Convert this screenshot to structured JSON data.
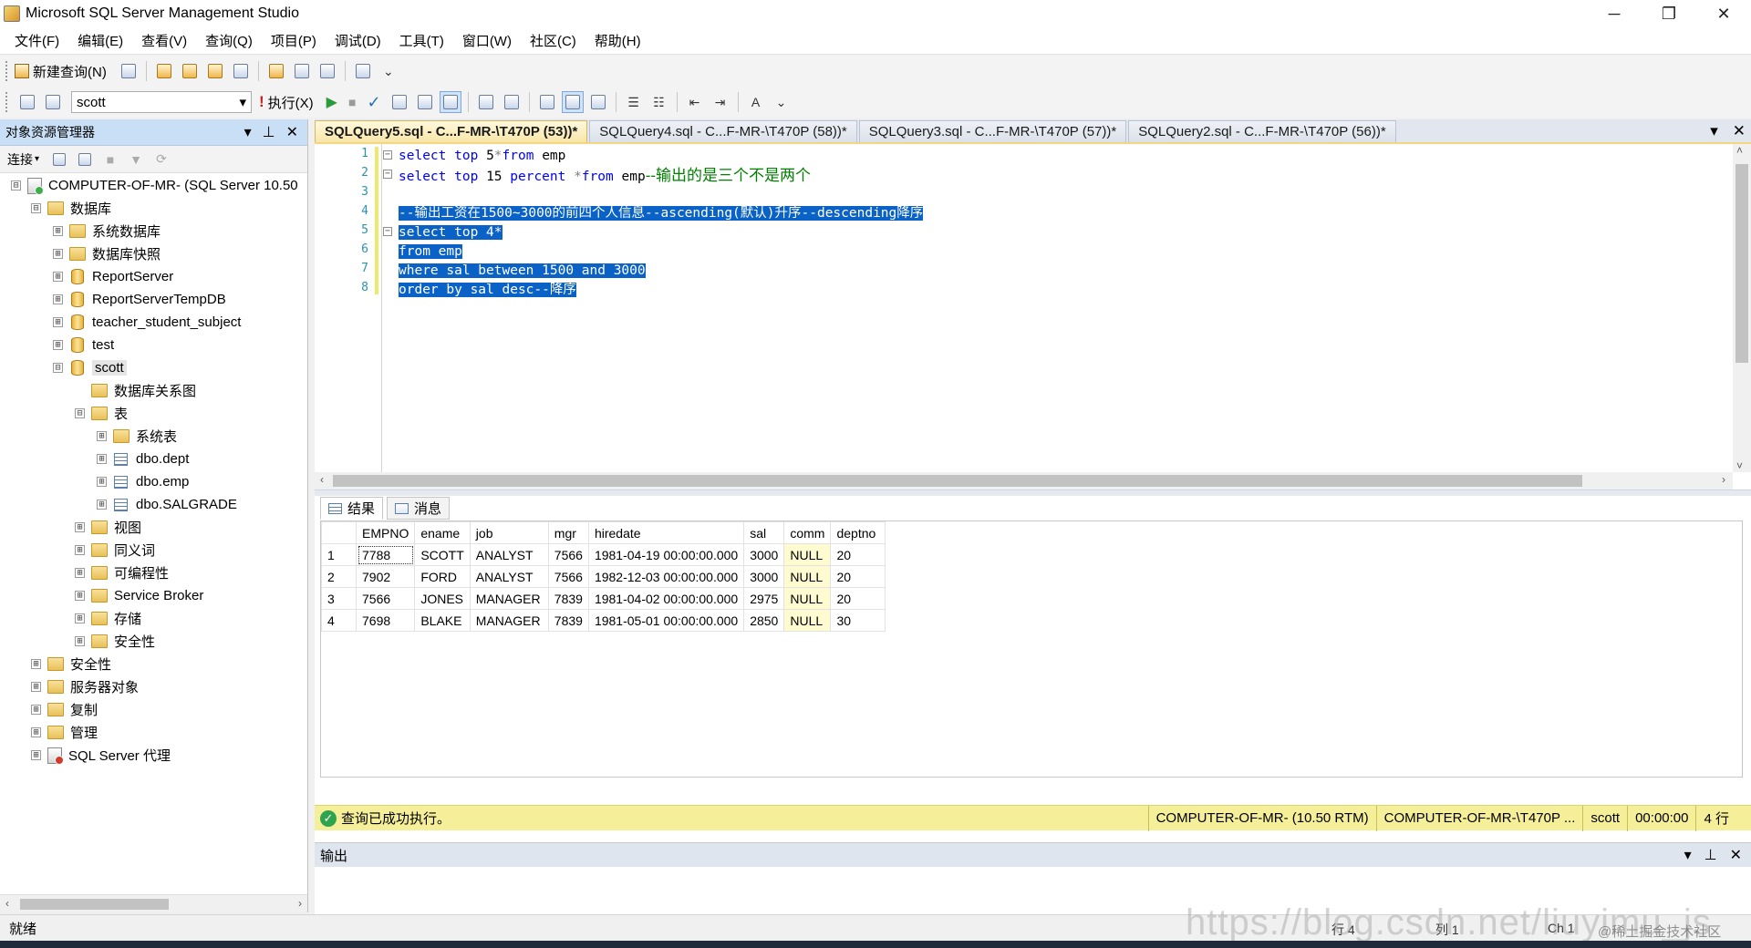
{
  "window": {
    "title": "Microsoft SQL Server Management Studio",
    "controls": [
      "─",
      "❐",
      "✕"
    ]
  },
  "menu": [
    "文件(F)",
    "编辑(E)",
    "查看(V)",
    "查询(Q)",
    "项目(P)",
    "调试(D)",
    "工具(T)",
    "窗口(W)",
    "社区(C)",
    "帮助(H)"
  ],
  "toolbar": {
    "new_query": "新建查询(N)",
    "database": "scott",
    "execute": "执行(X)"
  },
  "object_explorer": {
    "title": "对象资源管理器",
    "connect": "连接",
    "tree": [
      {
        "label": "COMPUTER-OF-MR- (SQL Server 10.50",
        "icon": "server-icon",
        "expander": "⊟"
      },
      {
        "label": "数据库",
        "icon": "folder-icon",
        "expander": "⊟"
      },
      {
        "label": "系统数据库",
        "icon": "folder-icon",
        "expander": "⊞"
      },
      {
        "label": "数据库快照",
        "icon": "folder-icon",
        "expander": "⊞"
      },
      {
        "label": "ReportServer",
        "icon": "database-icon",
        "expander": "⊞"
      },
      {
        "label": "ReportServerTempDB",
        "icon": "database-icon",
        "expander": "⊞"
      },
      {
        "label": "teacher_student_subject",
        "icon": "database-icon",
        "expander": "⊞"
      },
      {
        "label": "test",
        "icon": "database-icon",
        "expander": "⊞"
      },
      {
        "label": "scott",
        "icon": "database-icon",
        "expander": "⊟"
      },
      {
        "label": "数据库关系图",
        "icon": "folder-icon",
        "expander": ""
      },
      {
        "label": "表",
        "icon": "folder-icon",
        "expander": "⊟"
      },
      {
        "label": "系统表",
        "icon": "folder-icon",
        "expander": "⊞"
      },
      {
        "label": "dbo.dept",
        "icon": "table-icon",
        "expander": "⊞"
      },
      {
        "label": "dbo.emp",
        "icon": "table-icon",
        "expander": "⊞"
      },
      {
        "label": "dbo.SALGRADE",
        "icon": "table-icon",
        "expander": "⊞"
      },
      {
        "label": "视图",
        "icon": "folder-icon",
        "expander": "⊞"
      },
      {
        "label": "同义词",
        "icon": "folder-icon",
        "expander": "⊞"
      },
      {
        "label": "可编程性",
        "icon": "folder-icon",
        "expander": "⊞"
      },
      {
        "label": "Service Broker",
        "icon": "folder-icon",
        "expander": "⊞"
      },
      {
        "label": "存储",
        "icon": "folder-icon",
        "expander": "⊞"
      },
      {
        "label": "安全性",
        "icon": "folder-icon",
        "expander": "⊞"
      },
      {
        "label": "安全性",
        "icon": "folder-icon",
        "expander": "⊞"
      },
      {
        "label": "服务器对象",
        "icon": "folder-icon",
        "expander": "⊞"
      },
      {
        "label": "复制",
        "icon": "folder-icon",
        "expander": "⊞"
      },
      {
        "label": "管理",
        "icon": "folder-icon",
        "expander": "⊞"
      },
      {
        "label": "SQL Server 代理",
        "icon": "agent-icon",
        "expander": "⊞"
      }
    ]
  },
  "tabs": [
    {
      "label": "SQLQuery5.sql - C...F-MR-\\T470P (53))*",
      "active": true
    },
    {
      "label": "SQLQuery4.sql - C...F-MR-\\T470P (58))*",
      "active": false
    },
    {
      "label": "SQLQuery3.sql - C...F-MR-\\T470P (57))*",
      "active": false
    },
    {
      "label": "SQLQuery2.sql - C...F-MR-\\T470P (56))*",
      "active": false
    }
  ],
  "editor": {
    "line_numbers": [
      "1",
      "2",
      "3",
      "4",
      "5",
      "6",
      "7",
      "8"
    ],
    "lines": {
      "l1": {
        "kw1": "select",
        "kw2": "top",
        "num": "5",
        "star": "*",
        "kw3": "from",
        "tbl": "emp"
      },
      "l2": {
        "kw1": "select",
        "kw2": "top",
        "num": "15",
        "kw3": "percent",
        "star": "*",
        "kw4": "from",
        "tbl": "emp",
        "cmt": "--输出的是三个不是两个"
      },
      "l4": {
        "text": "--输出工资在1500~3000的前四个人信息--ascending(默认)升序--descending降序"
      },
      "l5": {
        "text": "select top 4*"
      },
      "l6": {
        "text": "from emp"
      },
      "l7": {
        "text": "where sal between 1500 and 3000"
      },
      "l8": {
        "text": "order by sal desc--降序"
      }
    }
  },
  "results": {
    "tab_results": "结果",
    "tab_messages": "消息",
    "columns": [
      "EMPNO",
      "ename",
      "job",
      "mgr",
      "hiredate",
      "sal",
      "comm",
      "deptno"
    ],
    "rows": [
      [
        "1",
        "7788",
        "SCOTT",
        "ANALYST",
        "7566",
        "1981-04-19 00:00:00.000",
        "3000",
        "NULL",
        "20"
      ],
      [
        "2",
        "7902",
        "FORD",
        "ANALYST",
        "7566",
        "1982-12-03 00:00:00.000",
        "3000",
        "NULL",
        "20"
      ],
      [
        "3",
        "7566",
        "JONES",
        "MANAGER",
        "7839",
        "1981-04-02 00:00:00.000",
        "2975",
        "NULL",
        "20"
      ],
      [
        "4",
        "7698",
        "BLAKE",
        "MANAGER",
        "7839",
        "1981-05-01 00:00:00.000",
        "2850",
        "NULL",
        "30"
      ]
    ]
  },
  "query_status": {
    "message": "查询已成功执行。",
    "server": "COMPUTER-OF-MR- (10.50 RTM)",
    "connection": "COMPUTER-OF-MR-\\T470P ...",
    "database": "scott",
    "elapsed": "00:00:00",
    "rows": "4 行"
  },
  "output": {
    "title": "输出"
  },
  "statusbar": {
    "ready": "就绪",
    "line": "行 4",
    "col": "列 1",
    "ch": "Ch 1"
  },
  "watermark": {
    "url": "https://blog.csdn.net/liuyimu_js",
    "community": "@稀土掘金技术社区"
  },
  "colors": {
    "selection": "#0a62c6",
    "keyword": "#0000ff",
    "comment": "#008000",
    "status_bar": "#f6ef9a",
    "active_tab": "#f8e6a8",
    "explorer_header": "#c9dff6"
  }
}
